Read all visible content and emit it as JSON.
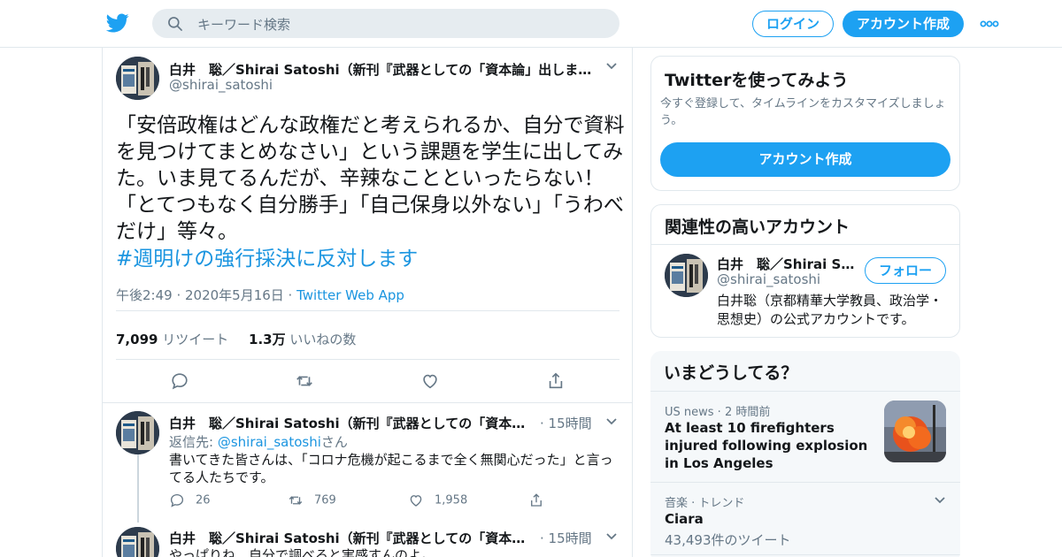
{
  "header": {
    "search_placeholder": "キーワード検索",
    "login_label": "ログイン",
    "signup_label": "アカウント作成",
    "brand_color": "#1da1f2"
  },
  "tweet": {
    "author_name": "白井　聡／Shirai Satoshi（新刊『武器としての「資本論」出しまし…",
    "handle": "@shirai_satoshi",
    "text": "「安倍政権はどんな政権だと考えられるか、自分で資料を見つけてまとめなさい」という課題を学生に出してみた。いま見てるんだが、辛辣なことといったらない！　「とてつもなく自分勝手」「自己保身以外ない」「うわべだけ」等々。",
    "hashtag": "#週明けの強行採決に反対します",
    "time": "午後2:49 · 2020年5月16日 · ",
    "source": "Twitter Web App",
    "retweet_count": "7,099",
    "retweet_label": "リツイート",
    "like_count": "1.3万",
    "like_label": "いいねの数"
  },
  "replies": [
    {
      "author_name": "白井　聡／Shirai Satoshi（新刊『武器としての「資本論」…",
      "time": "· 15時間",
      "reply_prefix": "返信先: ",
      "reply_handle": "@shirai_satoshi",
      "reply_suffix": "さん",
      "text": "書いてきた皆さんは、「コロナ危機が起こるまで全く無関心だった」と言ってる人たちです。",
      "replies": "26",
      "retweets": "769",
      "likes": "1,958"
    },
    {
      "author_name": "白井　聡／Shirai Satoshi（新刊『武器としての「資本論」…",
      "time": "· 15時間",
      "text": "やっぱりね、自分で調べると実感すんのよ。"
    }
  ],
  "sidebar": {
    "try_title": "Twitterを使ってみよう",
    "try_desc": "今すぐ登録して、タイムラインをカスタマイズしましょう。",
    "try_button": "アカウント作成",
    "related_title": "関連性の高いアカウント",
    "account_name": "白井　聡／Shirai Sa…",
    "account_handle": "@shirai_satoshi",
    "follow_label": "フォロー",
    "account_bio": "白井聡（京都精華大学教員、政治学・思想史）の公式アカウントです。",
    "trends_title": "いまどうしてる？",
    "trends": [
      {
        "meta": "US news · 2 時間前",
        "title": "At least 10 firefighters injured following explosion in Los Angeles"
      },
      {
        "meta": "音楽 · トレンド",
        "title": "Ciara",
        "count": "43,493件のツイート"
      }
    ]
  }
}
